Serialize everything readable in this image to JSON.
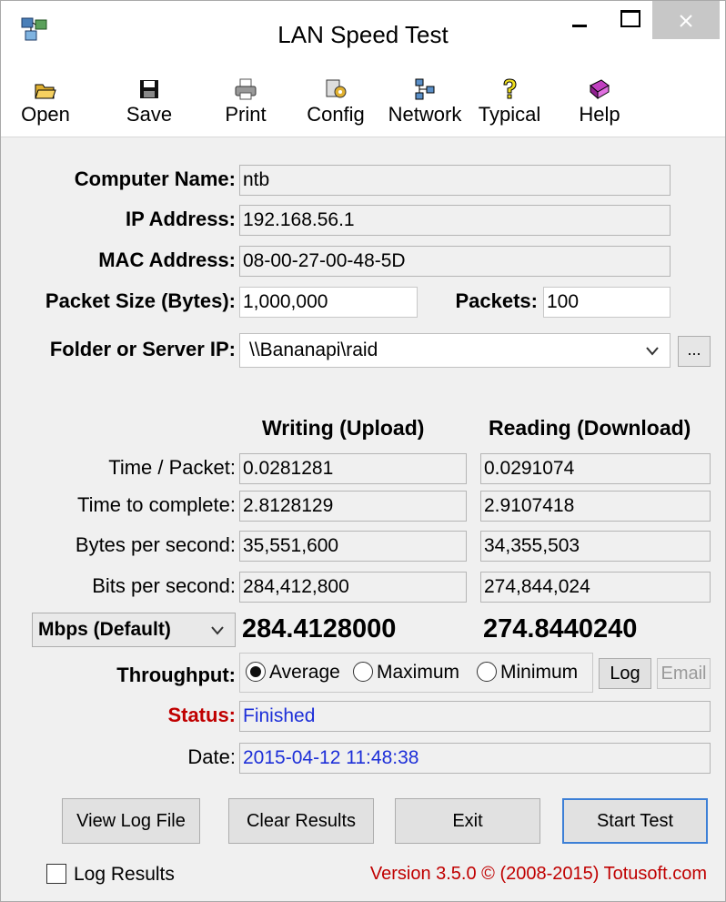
{
  "window": {
    "title": "LAN Speed Test"
  },
  "toolbar": {
    "open": "Open",
    "save": "Save",
    "print": "Print",
    "config": "Config",
    "network": "Network",
    "typical": "Typical",
    "help": "Help"
  },
  "info": {
    "computer_name_label": "Computer Name:",
    "computer_name": "ntb",
    "ip_label": "IP Address:",
    "ip": "192.168.56.1",
    "mac_label": "MAC Address:",
    "mac": "08-00-27-00-48-5D",
    "packet_size_label": "Packet Size (Bytes):",
    "packet_size": "1,000,000",
    "packets_label": "Packets:",
    "packets": "100",
    "folder_label": "Folder or Server IP:",
    "folder": "\\\\Bananapi\\raid",
    "browse": "..."
  },
  "results": {
    "write_header": "Writing (Upload)",
    "read_header": "Reading (Download)",
    "rows": [
      {
        "label": "Time / Packet:",
        "write": "0.0281281",
        "read": "0.0291074"
      },
      {
        "label": "Time to complete:",
        "write": "2.8128129",
        "read": "2.9107418"
      },
      {
        "label": "Bytes per second:",
        "write": "35,551,600",
        "read": "34,355,503"
      },
      {
        "label": "Bits per second:",
        "write": "284,412,800",
        "read": "274,844,024"
      }
    ],
    "unit": "Mbps (Default)",
    "write_big": "284.4128000",
    "read_big": "274.8440240"
  },
  "throughput": {
    "label": "Throughput:",
    "average": "Average",
    "maximum": "Maximum",
    "minimum": "Minimum",
    "selected": "Average",
    "log": "Log",
    "email": "Email"
  },
  "status": {
    "label": "Status:",
    "value": "Finished",
    "date_label": "Date:",
    "date": "2015-04-12 11:48:38"
  },
  "buttons": {
    "view_log": "View Log File",
    "clear": "Clear Results",
    "exit": "Exit",
    "start": "Start Test"
  },
  "footer": {
    "log_results": "Log Results",
    "version": "Version 3.5.0  © (2008-2015) Totusoft.com"
  },
  "colors": {
    "status": "#c00000",
    "value_blue": "#1d2fd8",
    "default_button_border": "#3c7fd6"
  }
}
